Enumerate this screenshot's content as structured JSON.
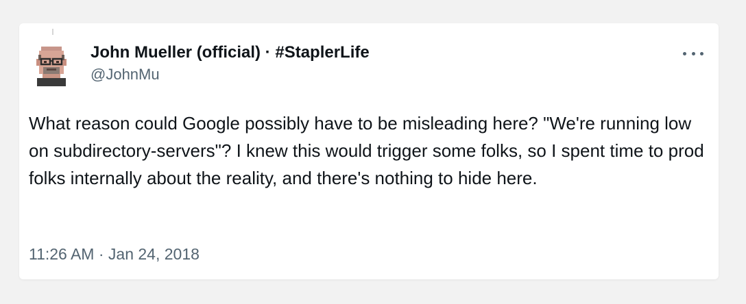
{
  "tweet": {
    "author_name": "John Mueller (official) · #StaplerLife",
    "author_handle": "@JohnMu",
    "text": "What reason could Google possibly have to be misleading here? \"We're running low on subdirectory-servers\"? I knew this would trigger some folks, so I spent time to prod folks internally about the reality, and there's nothing to hide here.",
    "timestamp": "11:26 AM · Jan 24, 2018",
    "more_icon": "more-horizontal-icon",
    "avatar_icon": "avatar-pixel-portrait"
  },
  "colors": {
    "background": "#f2f2f2",
    "card": "#ffffff",
    "primary_text": "#0f1419",
    "secondary_text": "#536471"
  }
}
